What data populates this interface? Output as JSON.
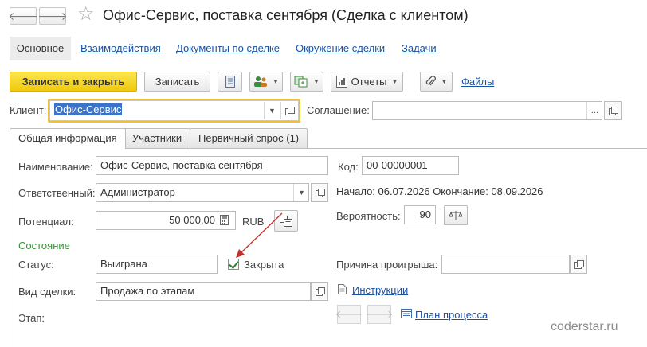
{
  "window": {
    "title": "Офис-Сервис, поставка сентября (Сделка с клиентом)",
    "back_glyph": "🡐",
    "forward_glyph": "🡒",
    "star_glyph": "☆"
  },
  "sections": {
    "main": "Основное",
    "interactions": "Взаимодействия",
    "documents": "Документы по сделке",
    "environment": "Окружение сделки",
    "tasks": "Задачи"
  },
  "toolbar": {
    "save_close": "Записать и закрыть",
    "save": "Записать",
    "reports": "Отчеты",
    "files": "Файлы"
  },
  "client": {
    "label": "Клиент:",
    "value": "Офис-Сервис"
  },
  "agreement": {
    "label": "Соглашение:",
    "value": ""
  },
  "tabs": {
    "general": "Общая информация",
    "participants": "Участники",
    "demand": "Первичный спрос (1)"
  },
  "form": {
    "name_label": "Наименование:",
    "name_value": "Офис-Сервис, поставка сентября",
    "code_label": "Код:",
    "code_value": "00-00000001",
    "responsible_label": "Ответственный:",
    "responsible_value": "Администратор",
    "dates_text": "Начало: 06.07.2026 Окончание: 08.09.2026",
    "potential_label": "Потенциал:",
    "potential_value": "50 000,00",
    "currency": "RUB",
    "probability_label": "Вероятность:",
    "probability_value": "90",
    "state_group": "Состояние",
    "status_label": "Статус:",
    "status_value": "Выиграна",
    "closed_label": "Закрыта",
    "closed_checked": true,
    "loss_reason_label": "Причина проигрыша:",
    "loss_reason_value": "",
    "deal_type_label": "Вид сделки:",
    "deal_type_value": "Продажа по этапам",
    "instructions_link": "Инструкции",
    "stage_label": "Этап:",
    "process_plan_link": "План процесса"
  },
  "watermark": "coderstar.ru",
  "colors": {
    "primary_button": "#f0c90c",
    "link": "#1c53a0",
    "group_title": "#3c8f3c",
    "arrow": "#c0312b"
  }
}
